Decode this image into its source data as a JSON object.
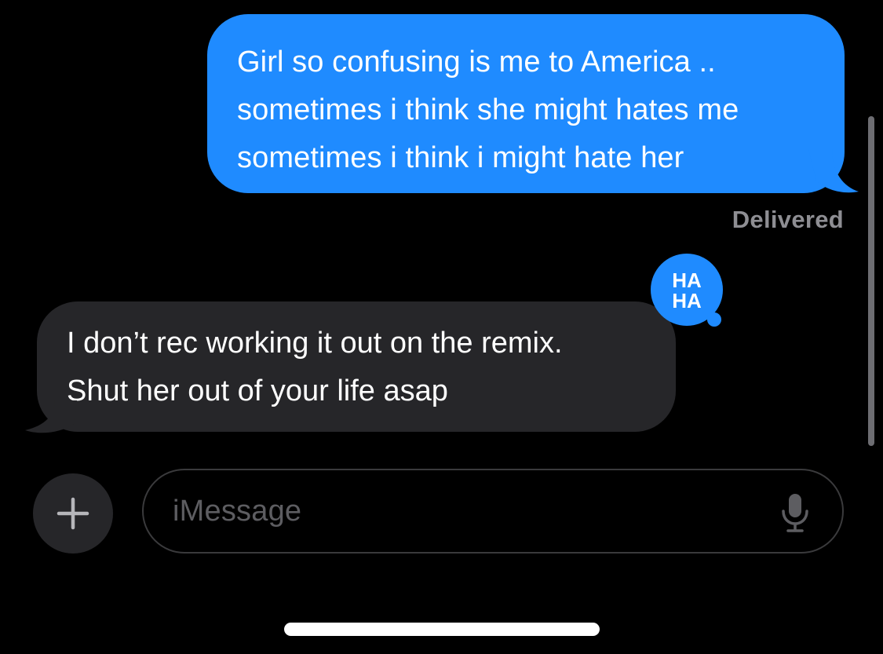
{
  "messages": {
    "outgoing": {
      "lines": [
        "Girl so confusing is me to America ..",
        "sometimes i think she might hates me",
        "sometimes i think i might hate her"
      ],
      "status": "Delivered",
      "color": "#1f8bff"
    },
    "incoming": {
      "lines": [
        "I don’t rec working it out on the remix.",
        "Shut her out of your life asap"
      ],
      "color": "#262629",
      "tapback": {
        "icon": "haha-tapback-icon",
        "text_top": "HA",
        "text_bottom": "HA"
      }
    }
  },
  "compose": {
    "add_button_icon": "plus-icon",
    "placeholder": "iMessage",
    "mic_icon": "microphone-icon"
  }
}
